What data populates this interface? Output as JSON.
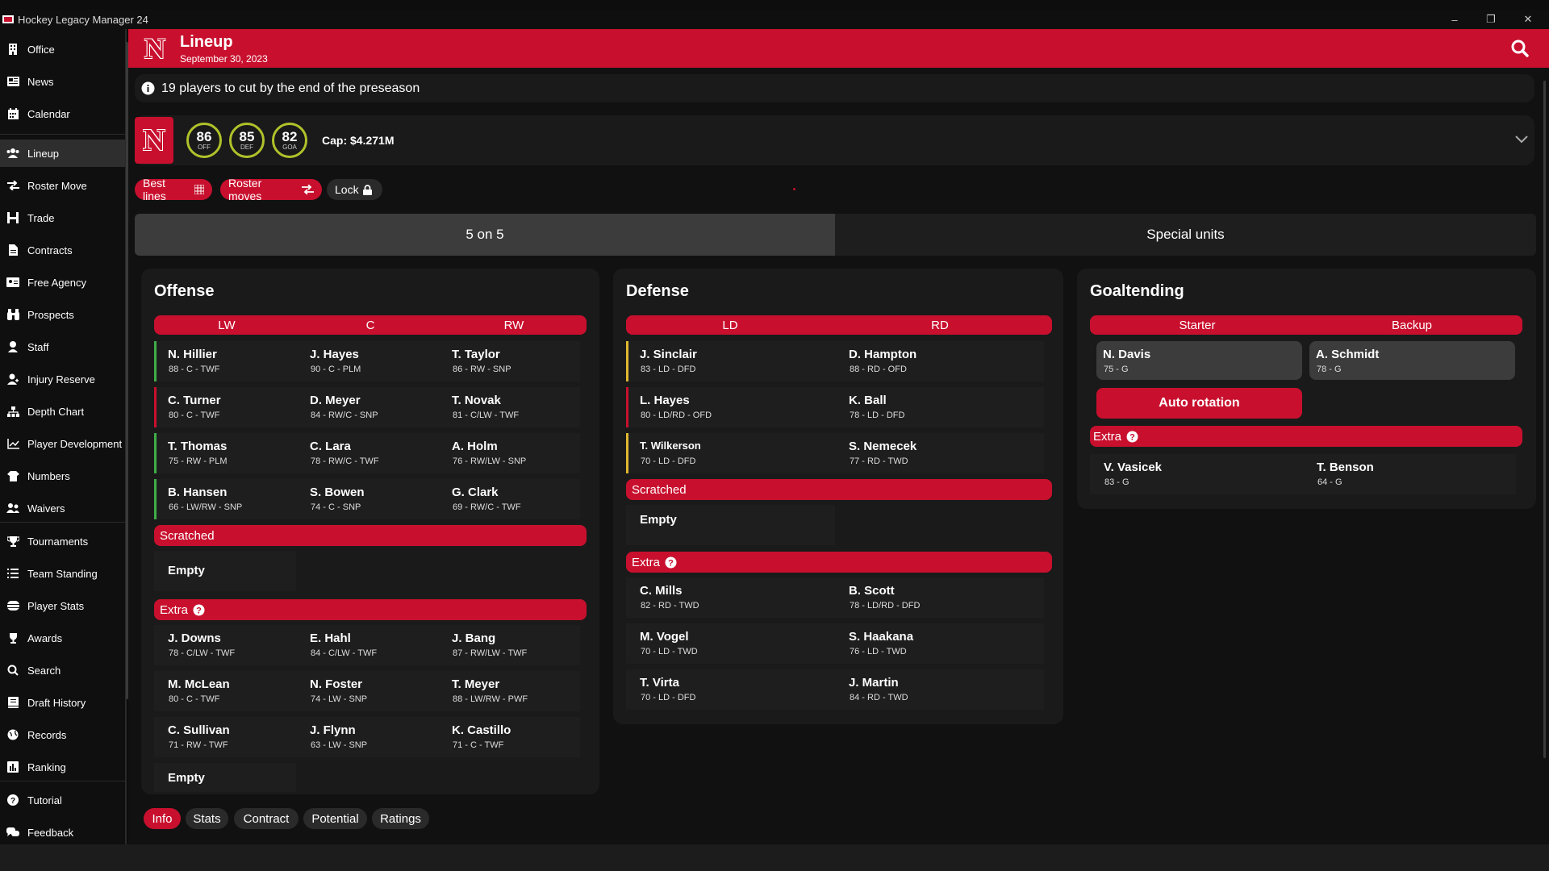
{
  "window": {
    "title": "Hockey Legacy Manager 24",
    "minimize": "–",
    "restore": "❐",
    "close": "✕"
  },
  "sidebar": {
    "items": [
      {
        "label": "Office",
        "icon": "building-icon"
      },
      {
        "label": "News",
        "icon": "newspaper-icon"
      },
      {
        "label": "Calendar",
        "icon": "calendar-icon"
      },
      {
        "label": "Lineup",
        "icon": "users-icon"
      },
      {
        "label": "Roster Move",
        "icon": "swap-icon"
      },
      {
        "label": "Trade",
        "icon": "trade-icon"
      },
      {
        "label": "Contracts",
        "icon": "document-icon"
      },
      {
        "label": "Free Agency",
        "icon": "id-card-icon"
      },
      {
        "label": "Prospects",
        "icon": "binoculars-icon"
      },
      {
        "label": "Staff",
        "icon": "user-tie-icon"
      },
      {
        "label": "Injury Reserve",
        "icon": "injury-icon"
      },
      {
        "label": "Depth Chart",
        "icon": "sitemap-icon"
      },
      {
        "label": "Player Development",
        "icon": "chart-line-icon"
      },
      {
        "label": "Numbers",
        "icon": "jersey-icon"
      },
      {
        "label": "Waivers",
        "icon": "user-group-icon"
      },
      {
        "label": "Tournaments",
        "icon": "trophy-icon"
      },
      {
        "label": "Team Standing",
        "icon": "list-icon"
      },
      {
        "label": "Player Stats",
        "icon": "database-icon"
      },
      {
        "label": "Awards",
        "icon": "award-icon"
      },
      {
        "label": "Search",
        "icon": "search-icon"
      },
      {
        "label": "Draft History",
        "icon": "book-icon"
      },
      {
        "label": "Records",
        "icon": "globe-icon"
      },
      {
        "label": "Ranking",
        "icon": "bar-chart-icon"
      },
      {
        "label": "Tutorial",
        "icon": "question-icon"
      },
      {
        "label": "Feedback",
        "icon": "comments-icon"
      }
    ]
  },
  "header": {
    "title": "Lineup",
    "date": "September 30, 2023",
    "logo": "N"
  },
  "notice": {
    "text": "19 players to cut by the end of the preseason"
  },
  "team": {
    "logo": "N",
    "ratings": [
      {
        "value": "86",
        "label": "OFF"
      },
      {
        "value": "85",
        "label": "DEF"
      },
      {
        "value": "82",
        "label": "GOA"
      }
    ],
    "cap": "Cap: $4.271M"
  },
  "actions": {
    "best_lines": "Best lines",
    "roster_moves": "Roster moves",
    "lock": "Lock"
  },
  "tabs": {
    "five_on_five": "5 on 5",
    "special_units": "Special units"
  },
  "offense": {
    "title": "Offense",
    "cols": [
      "LW",
      "C",
      "RW"
    ],
    "lines": [
      [
        {
          "name": "N. Hillier",
          "info": "88 - C - TWF"
        },
        {
          "name": "J. Hayes",
          "info": "90 - C - PLM"
        },
        {
          "name": "T. Taylor",
          "info": "86 - RW - SNP"
        }
      ],
      [
        {
          "name": "C. Turner",
          "info": "80 - C - TWF"
        },
        {
          "name": "D. Meyer",
          "info": "84 - RW/C - SNP"
        },
        {
          "name": "T. Novak",
          "info": "81 - C/LW - TWF"
        }
      ],
      [
        {
          "name": "T. Thomas",
          "info": "75 - RW - PLM"
        },
        {
          "name": "C. Lara",
          "info": "78 - RW/C - TWF"
        },
        {
          "name": "A. Holm",
          "info": "76 - RW/LW - SNP"
        }
      ],
      [
        {
          "name": "B. Hansen",
          "info": "66 - LW/RW - SNP"
        },
        {
          "name": "S. Bowen",
          "info": "74 - C - SNP"
        },
        {
          "name": "G. Clark",
          "info": "69 - RW/C - TWF"
        }
      ]
    ],
    "scratched_label": "Scratched",
    "scratched_empty": "Empty",
    "extra_label": "Extra",
    "extra": [
      {
        "name": "J. Downs",
        "info": "78 - C/LW - TWF"
      },
      {
        "name": "E. Hahl",
        "info": "84 - C/LW - TWF"
      },
      {
        "name": "J. Bang",
        "info": "87 - RW/LW - TWF"
      },
      {
        "name": "M. McLean",
        "info": "80 - C - TWF"
      },
      {
        "name": "N. Foster",
        "info": "74 - LW - SNP"
      },
      {
        "name": "T. Meyer",
        "info": "88 - LW/RW - PWF"
      },
      {
        "name": "C. Sullivan",
        "info": "71 - RW - TWF"
      },
      {
        "name": "J. Flynn",
        "info": "63 - LW - SNP"
      },
      {
        "name": "K. Castillo",
        "info": "71 - C - TWF"
      }
    ],
    "extra_empty": "Empty"
  },
  "defense": {
    "title": "Defense",
    "cols": [
      "LD",
      "RD"
    ],
    "pairs": [
      [
        {
          "name": "J. Sinclair",
          "info": "83 - LD - DFD"
        },
        {
          "name": "D. Hampton",
          "info": "88 - RD - OFD"
        }
      ],
      [
        {
          "name": "L. Hayes",
          "info": "80 - LD/RD - OFD"
        },
        {
          "name": "K. Ball",
          "info": "78 - LD - DFD"
        }
      ],
      [
        {
          "name": "T. Wilkerson",
          "info": "70 - LD - DFD"
        },
        {
          "name": "S. Nemecek",
          "info": "77 - RD - TWD"
        }
      ]
    ],
    "scratched_label": "Scratched",
    "scratched_empty": "Empty",
    "extra_label": "Extra",
    "extra": [
      {
        "name": "C. Mills",
        "info": "82 - RD - TWD"
      },
      {
        "name": "B. Scott",
        "info": "78 - LD/RD - DFD"
      },
      {
        "name": "M. Vogel",
        "info": "70 - LD - TWD"
      },
      {
        "name": "S. Haakana",
        "info": "76 - LD - TWD"
      },
      {
        "name": "T. Virta",
        "info": "70 - LD - DFD"
      },
      {
        "name": "J. Martin",
        "info": "84 - RD - TWD"
      }
    ]
  },
  "goaltending": {
    "title": "Goaltending",
    "cols": [
      "Starter",
      "Backup"
    ],
    "starter": {
      "name": "N. Davis",
      "info": "75 - G"
    },
    "backup": {
      "name": "A. Schmidt",
      "info": "78 - G"
    },
    "auto_rotation": "Auto rotation",
    "extra_label": "Extra",
    "extra": [
      {
        "name": "V. Vasicek",
        "info": "83 - G"
      },
      {
        "name": "T. Benson",
        "info": "64 - G"
      }
    ]
  },
  "bottom_tabs": [
    "Info",
    "Stats",
    "Contract",
    "Potential",
    "Ratings"
  ],
  "colors": {
    "accent": "#c8102e",
    "line_green": "#3fae49",
    "line_red": "#c8102e",
    "line_yellow": "#e0b830",
    "rating_ring": "#b0c22a"
  }
}
